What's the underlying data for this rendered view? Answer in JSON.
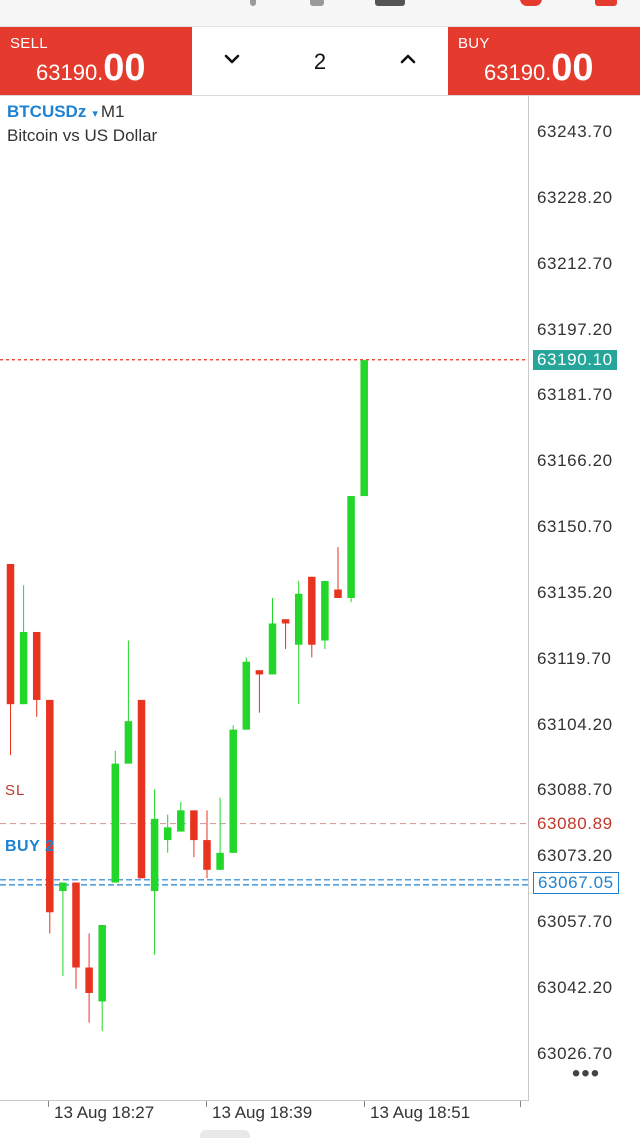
{
  "trade_bar": {
    "sell_label": "SELL",
    "sell_price_main": "63190.",
    "sell_price_big": "00",
    "buy_label": "BUY",
    "buy_price_main": "63190.",
    "buy_price_big": "00",
    "volume": "2",
    "decrease_icon": "chevron-down-icon",
    "increase_icon": "chevron-up-icon"
  },
  "chart": {
    "symbol": "BTCUSDz",
    "dropdown_glyph": "▾",
    "timeframe": "M1",
    "description": "Bitcoin vs US Dollar",
    "sl_label": "SL",
    "order_label": "BUY 2",
    "more_icon": "more-dots-icon",
    "more_glyph": "•••",
    "colors": {
      "bull": "#22d62a",
      "bear": "#e8331e",
      "bid_line": "#e8331e",
      "sl_line": "#d4a0a0",
      "order_line": "#1e82d2",
      "bid_tag": "#26a69a"
    }
  },
  "chart_data": {
    "type": "candlestick",
    "symbol": "BTCUSDz",
    "timeframe": "M1",
    "ylim": [
      63015.8,
      63252.2
    ],
    "y_ticks": [
      "63243.70",
      "63228.20",
      "63212.70",
      "63197.20",
      "63181.70",
      "63166.20",
      "63150.70",
      "63135.20",
      "63119.70",
      "63104.20",
      "63088.70",
      "63073.20",
      "63057.70",
      "63042.20",
      "63026.70"
    ],
    "bid_price": "63190.10",
    "sl_price": "63080.89",
    "order_price": "63067.05",
    "x_labels": [
      "13 Aug 18:27",
      "13 Aug 18:39",
      "13 Aug 18:51"
    ],
    "candles": [
      {
        "o": 63142,
        "h": 63142,
        "c": 63109,
        "l": 63097
      },
      {
        "o": 63109,
        "h": 63137,
        "c": 63126,
        "l": 63109
      },
      {
        "o": 63126,
        "h": 63126,
        "c": 63110,
        "l": 63106
      },
      {
        "o": 63110,
        "h": 63110,
        "c": 63060,
        "l": 63055
      },
      {
        "o": 63065,
        "h": 63067,
        "c": 63067,
        "l": 63045
      },
      {
        "o": 63067,
        "h": 63067,
        "c": 63047,
        "l": 63042
      },
      {
        "o": 63047,
        "h": 63055,
        "c": 63041,
        "l": 63034
      },
      {
        "o": 63039,
        "h": 63057,
        "c": 63057,
        "l": 63032
      },
      {
        "o": 63067,
        "h": 63098,
        "c": 63095,
        "l": 63067
      },
      {
        "o": 63095,
        "h": 63124,
        "c": 63105,
        "l": 63095
      },
      {
        "o": 63110,
        "h": 63110,
        "c": 63068,
        "l": 63068
      },
      {
        "o": 63065,
        "h": 63089,
        "c": 63082,
        "l": 63050
      },
      {
        "o": 63077,
        "h": 63083,
        "c": 63080,
        "l": 63074
      },
      {
        "o": 63079,
        "h": 63086,
        "c": 63084,
        "l": 63079
      },
      {
        "o": 63084,
        "h": 63084,
        "c": 63077,
        "l": 63073
      },
      {
        "o": 63077,
        "h": 63084,
        "c": 63070,
        "l": 63068
      },
      {
        "o": 63070,
        "h": 63087,
        "c": 63074,
        "l": 63070
      },
      {
        "o": 63074,
        "h": 63104,
        "c": 63103,
        "l": 63074
      },
      {
        "o": 63103,
        "h": 63120,
        "c": 63119,
        "l": 63103
      },
      {
        "o": 63117,
        "h": 63117,
        "c": 63116,
        "l": 63107
      },
      {
        "o": 63116,
        "h": 63134,
        "c": 63128,
        "l": 63116
      },
      {
        "o": 63129,
        "h": 63129,
        "c": 63128,
        "l": 63122
      },
      {
        "o": 63123,
        "h": 63138,
        "c": 63135,
        "l": 63109
      },
      {
        "o": 63139,
        "h": 63139,
        "c": 63123,
        "l": 63120
      },
      {
        "o": 63124,
        "h": 63138,
        "c": 63138,
        "l": 63122
      },
      {
        "o": 63136,
        "h": 63146,
        "c": 63134,
        "l": 63134
      },
      {
        "o": 63134,
        "h": 63158,
        "c": 63158,
        "l": 63133
      },
      {
        "o": 63158,
        "h": 63190,
        "c": 63190,
        "l": 63158
      }
    ]
  }
}
